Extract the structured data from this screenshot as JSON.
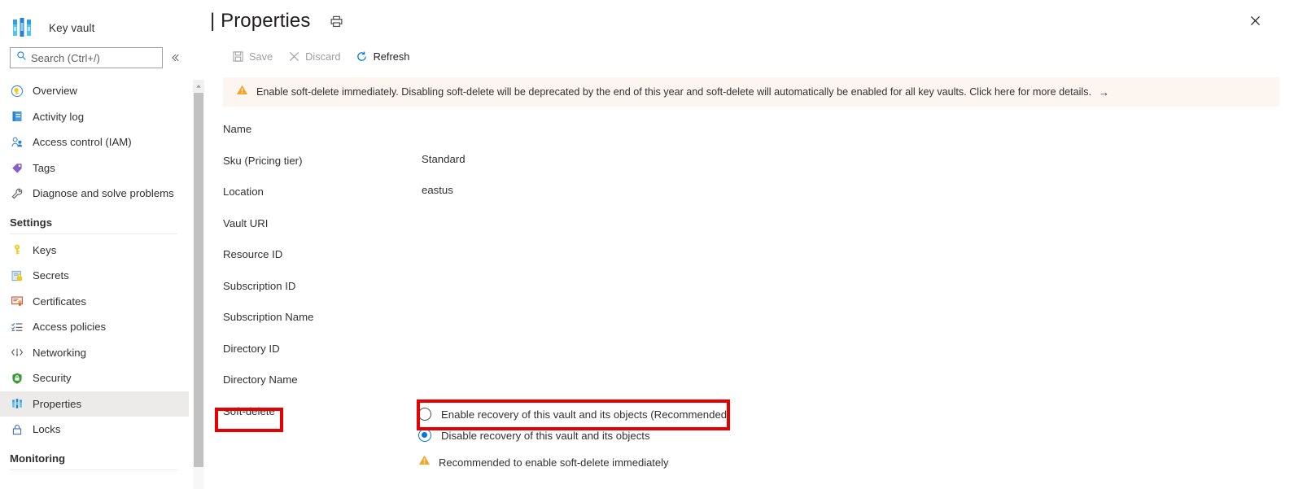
{
  "brand": {
    "accent": "#0078d4",
    "warning": "#f7a325",
    "annotation": "#e60000",
    "selected_bg": "#edebe9",
    "banner_bg": "#fdf6f0"
  },
  "sidebar": {
    "resource_type": "Key vault",
    "logo_icon": "key-vault-icon",
    "search": {
      "placeholder": "Search (Ctrl+/)",
      "value": "",
      "icon": "search-icon"
    },
    "collapse_icon": "chevron-double-left-icon",
    "items": [
      {
        "label": "Overview",
        "icon": "overview-key-icon",
        "selected": false
      },
      {
        "label": "Activity log",
        "icon": "activity-log-icon",
        "selected": false
      },
      {
        "label": "Access control (IAM)",
        "icon": "access-control-icon",
        "selected": false
      },
      {
        "label": "Tags",
        "icon": "tags-icon",
        "selected": false
      },
      {
        "label": "Diagnose and solve problems",
        "icon": "diagnose-wrench-icon",
        "selected": false
      }
    ],
    "groups": [
      {
        "title": "Settings",
        "items": [
          {
            "label": "Keys",
            "icon": "key-icon",
            "selected": false
          },
          {
            "label": "Secrets",
            "icon": "secrets-icon",
            "selected": false
          },
          {
            "label": "Certificates",
            "icon": "certificates-icon",
            "selected": false
          },
          {
            "label": "Access policies",
            "icon": "access-policies-icon",
            "selected": false
          },
          {
            "label": "Networking",
            "icon": "networking-icon",
            "selected": false
          },
          {
            "label": "Security",
            "icon": "security-shield-icon",
            "selected": false
          },
          {
            "label": "Properties",
            "icon": "properties-icon",
            "selected": true
          },
          {
            "label": "Locks",
            "icon": "lock-icon",
            "selected": false
          }
        ]
      },
      {
        "title": "Monitoring",
        "items": []
      }
    ],
    "scrollbar": {
      "up_arrow_icon": "scroll-up-arrow-icon"
    }
  },
  "header": {
    "title": "| Properties",
    "print_icon": "print-icon",
    "close_icon": "close-icon"
  },
  "toolbar": {
    "commands": [
      {
        "label": "Save",
        "icon": "save-icon",
        "disabled": true
      },
      {
        "label": "Discard",
        "icon": "discard-x-icon",
        "disabled": true
      },
      {
        "label": "Refresh",
        "icon": "refresh-icon",
        "disabled": false
      }
    ]
  },
  "banner": {
    "icon": "warning-triangle-icon",
    "text": "Enable soft-delete immediately. Disabling soft-delete will be deprecated by the end of this year and soft-delete will automatically be enabled for all key vaults. Click here for more details.",
    "arrow": "→"
  },
  "form": {
    "fields": [
      {
        "label": "Name",
        "value": ""
      },
      {
        "label": "Sku (Pricing tier)",
        "value": "Standard"
      },
      {
        "label": "Location",
        "value": "eastus"
      },
      {
        "label": "Vault URI",
        "value": ""
      },
      {
        "label": "Resource ID",
        "value": ""
      },
      {
        "label": "Subscription ID",
        "value": ""
      },
      {
        "label": "Subscription Name",
        "value": ""
      },
      {
        "label": "Directory ID",
        "value": ""
      },
      {
        "label": "Directory Name",
        "value": ""
      },
      {
        "label": "Soft-delete",
        "value": ""
      }
    ],
    "soft_delete": {
      "options": [
        {
          "label": "Enable recovery of this vault and its objects (Recommended)",
          "selected": false
        },
        {
          "label": "Disable recovery of this vault and its objects",
          "selected": true
        }
      ],
      "note": {
        "icon": "warning-triangle-icon",
        "text": "Recommended to enable soft-delete immediately"
      }
    }
  },
  "annotations": [
    {
      "name": "soft-delete-label-highlight",
      "color": "#e60000"
    },
    {
      "name": "enable-recovery-option-highlight",
      "color": "#e60000"
    }
  ]
}
